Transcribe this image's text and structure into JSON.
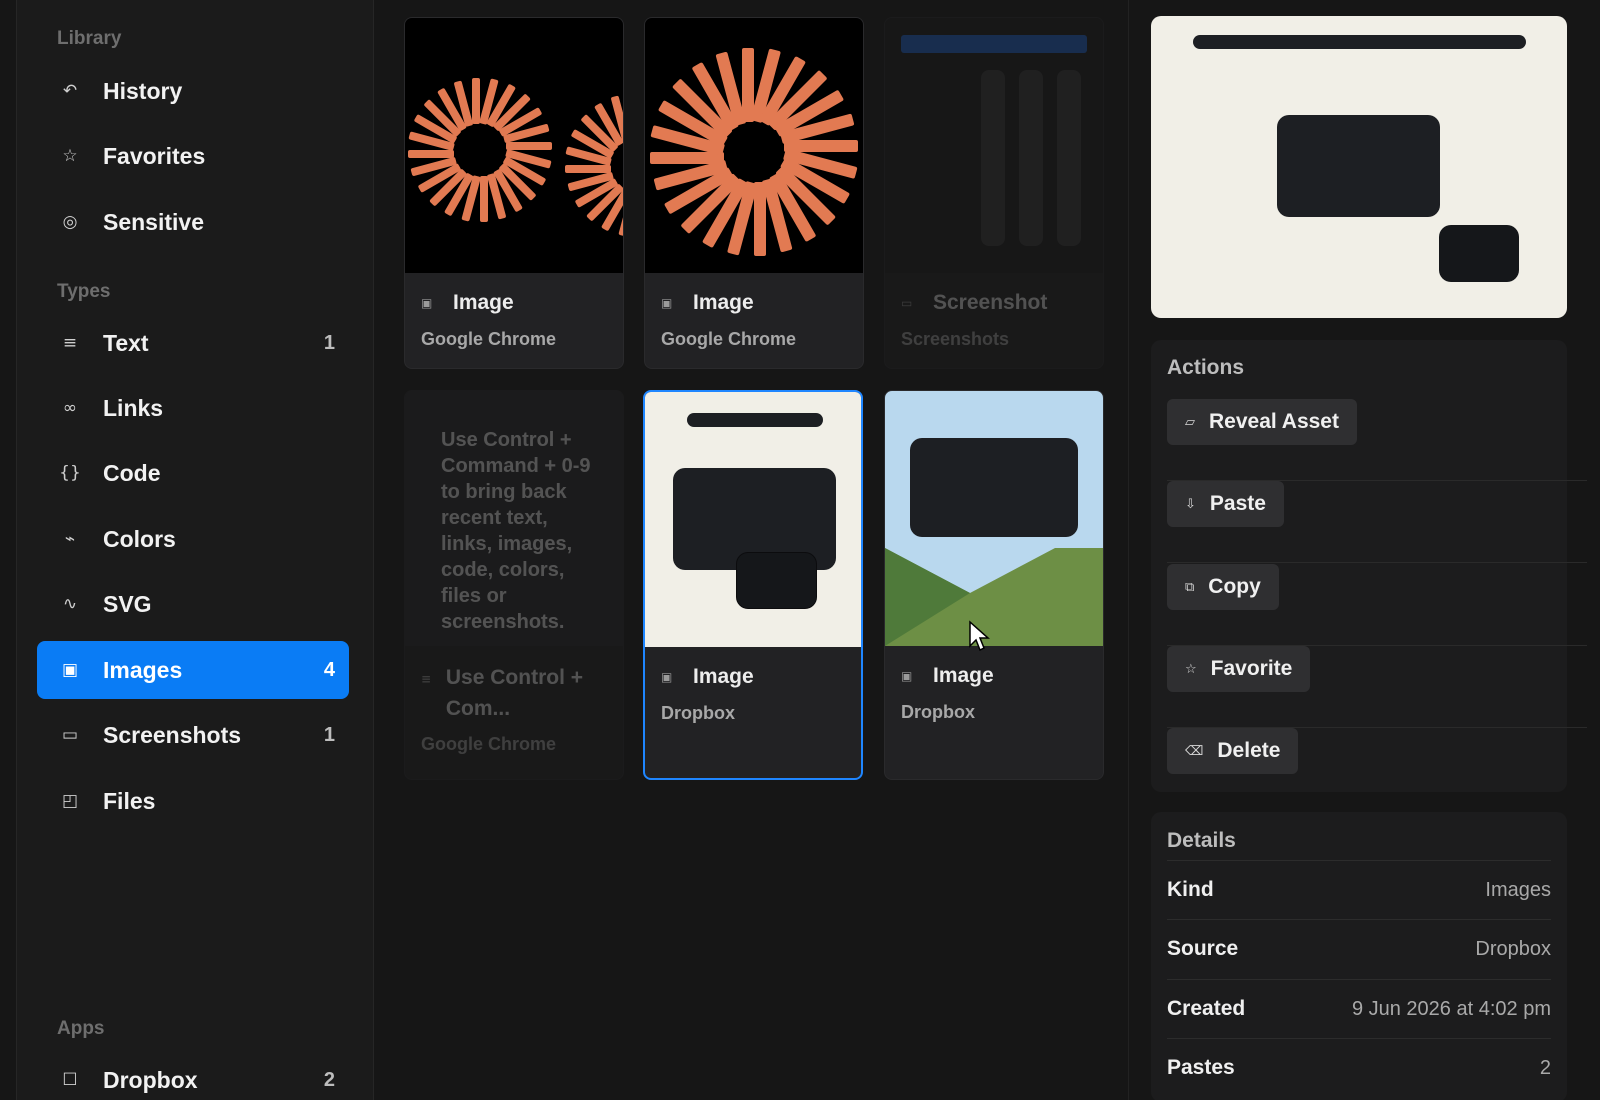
{
  "sidebar": {
    "library_title": "Library",
    "library": [
      {
        "icon": "↶",
        "label": "History"
      },
      {
        "icon": "☆",
        "label": "Favorites"
      },
      {
        "icon": "◎",
        "label": "Sensitive"
      }
    ],
    "types_title": "Types",
    "types": [
      {
        "icon": "≡",
        "label": "Text",
        "count": "1"
      },
      {
        "icon": "∞",
        "label": "Links",
        "count": ""
      },
      {
        "icon": "{}",
        "label": "Code",
        "count": ""
      },
      {
        "icon": "⌁",
        "label": "Colors",
        "count": ""
      },
      {
        "icon": "∿",
        "label": "SVG",
        "count": ""
      },
      {
        "icon": "▣",
        "label": "Images",
        "count": "4"
      },
      {
        "icon": "▭",
        "label": "Screenshots",
        "count": "1"
      },
      {
        "icon": "◰",
        "label": "Files",
        "count": ""
      }
    ],
    "apps_title": "Apps",
    "apps": [
      {
        "icon": "☐",
        "label": "Dropbox",
        "count": "2"
      }
    ]
  },
  "grid": {
    "cards": [
      {
        "kind": "Image",
        "source": "Google Chrome"
      },
      {
        "kind": "Image",
        "source": "Google Chrome"
      },
      {
        "kind": "Screenshot",
        "source": "Screenshots"
      },
      {
        "text": "Use Control + Command + 0-9 to bring back recent text, links, images, code, colors, files or screenshots.",
        "kind": "Use Control + Com...",
        "source": "Google Chrome"
      },
      {
        "kind": "Image",
        "source": "Dropbox"
      },
      {
        "kind": "Image",
        "source": "Dropbox"
      }
    ]
  },
  "panel": {
    "actions_title": "Actions",
    "actions": [
      {
        "icon": "▱",
        "label": "Reveal Asset"
      },
      {
        "icon": "⇩",
        "label": "Paste"
      },
      {
        "icon": "⧉",
        "label": "Copy"
      },
      {
        "icon": "☆",
        "label": "Favorite"
      },
      {
        "icon": "⌫",
        "label": "Delete"
      }
    ],
    "details_title": "Details",
    "details": [
      {
        "key": "Kind",
        "value": "Images"
      },
      {
        "key": "Source",
        "value": "Dropbox"
      },
      {
        "key": "Created",
        "value": "9 Jun 2026 at 4:02 pm"
      },
      {
        "key": "Pastes",
        "value": "2"
      }
    ]
  },
  "colors": {
    "accent": "#0a7cf5",
    "burst": "#e27a52",
    "preview_bg": "#f1efe7",
    "sky": "#b9d8ee",
    "hill_dark": "#4f7a3a",
    "hill_light": "#6d8f45"
  }
}
